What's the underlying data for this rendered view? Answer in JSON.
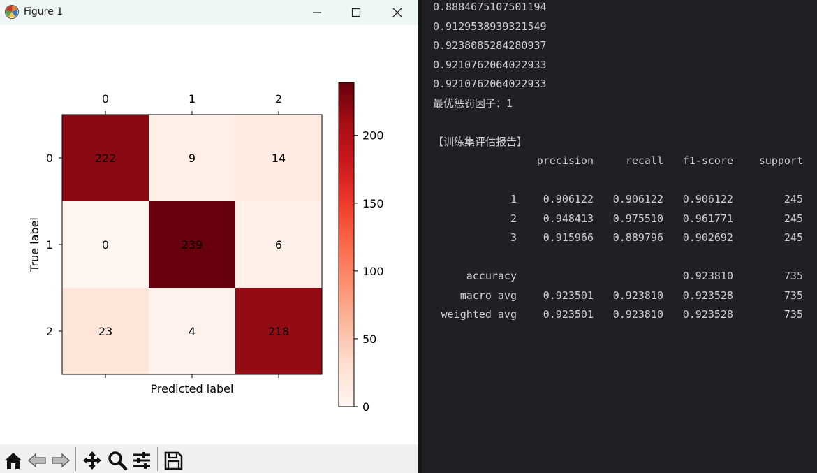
{
  "window": {
    "title": "Figure 1",
    "minimize_icon": "minimize-icon",
    "maximize_icon": "maximize-icon",
    "close_icon": "close-icon",
    "app_icon": "matplotlib-logo-icon"
  },
  "chart_data": {
    "type": "heatmap",
    "title": "",
    "xlabel": "Predicted label",
    "ylabel": "True label",
    "x_categories": [
      "0",
      "1",
      "2"
    ],
    "y_categories": [
      "0",
      "1",
      "2"
    ],
    "matrix": [
      [
        222,
        9,
        14
      ],
      [
        0,
        239,
        6
      ],
      [
        23,
        4,
        218
      ]
    ],
    "colormap": "Reds",
    "colorbar": {
      "min": 0,
      "max": 239,
      "ticks": [
        0,
        50,
        100,
        150,
        200
      ]
    },
    "x_axis_position": "top"
  },
  "toolbar": {
    "items": [
      "home-icon",
      "back-icon",
      "forward-icon",
      "pan-icon",
      "zoom-icon",
      "configure-subplots-icon",
      "save-icon"
    ]
  },
  "terminal": {
    "scores": [
      "0.8884675107501194",
      "0.9129538939321549",
      "0.9238085284280937",
      "0.9210762064022933",
      "0.9210762064022933"
    ],
    "best_factor_line": "最优惩罚因子：1",
    "report_title": "【训练集评估报告】",
    "report_headers": [
      "precision",
      "recall",
      "f1-score",
      "support"
    ],
    "report_rows": [
      {
        "label": "1",
        "precision": "0.906122",
        "recall": "0.906122",
        "f1": "0.906122",
        "support": "245"
      },
      {
        "label": "2",
        "precision": "0.948413",
        "recall": "0.975510",
        "f1": "0.961771",
        "support": "245"
      },
      {
        "label": "3",
        "precision": "0.915966",
        "recall": "0.889796",
        "f1": "0.902692",
        "support": "245"
      }
    ],
    "summary_rows": [
      {
        "label": "accuracy",
        "precision": "",
        "recall": "",
        "f1": "0.923810",
        "support": "735"
      },
      {
        "label": "macro avg",
        "precision": "0.923501",
        "recall": "0.923810",
        "f1": "0.923528",
        "support": "735"
      },
      {
        "label": "weighted avg",
        "precision": "0.923501",
        "recall": "0.923810",
        "f1": "0.923528",
        "support": "735"
      }
    ]
  }
}
